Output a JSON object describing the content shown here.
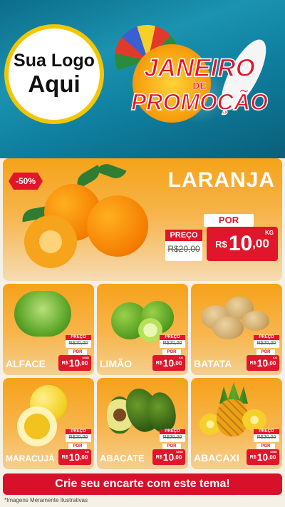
{
  "logo": {
    "line1": "Sua Logo",
    "line2": "Aqui"
  },
  "promo": {
    "line1": "JANEIRO",
    "line2": "DE",
    "line3": "PROMOÇÃO"
  },
  "hero": {
    "name": "LARANJA",
    "discount": "-50%",
    "preco_label": "PREÇO",
    "old_price": "R$20,00",
    "por_label": "POR",
    "currency": "R$",
    "price_int": "10",
    "price_dec": ",00",
    "unit": "KG"
  },
  "products": [
    {
      "name": "ALFACE",
      "preco_label": "PREÇO",
      "old_price": "R$20,00",
      "por_label": "POR",
      "currency": "R$",
      "price_int": "10",
      "price_dec": ",00",
      "unit": "UNID"
    },
    {
      "name": "LIMÃO",
      "preco_label": "PREÇO",
      "old_price": "R$20,00",
      "por_label": "POR",
      "currency": "R$",
      "price_int": "10",
      "price_dec": ",00",
      "unit": "KG"
    },
    {
      "name": "BATATA",
      "preco_label": "PREÇO",
      "old_price": "R$20,00",
      "por_label": "POR",
      "currency": "R$",
      "price_int": "10",
      "price_dec": ",00",
      "unit": "KG"
    },
    {
      "name": "MARACUJÁ",
      "preco_label": "PREÇO",
      "old_price": "R$20,00",
      "por_label": "POR",
      "currency": "R$",
      "price_int": "10",
      "price_dec": ",00",
      "unit": "KG"
    },
    {
      "name": "ABACATE",
      "preco_label": "PREÇO",
      "old_price": "R$20,00",
      "por_label": "POR",
      "currency": "R$",
      "price_int": "10",
      "price_dec": ",00",
      "unit": "UNID"
    },
    {
      "name": "ABACAXI",
      "preco_label": "PREÇO",
      "old_price": "R$20,00",
      "por_label": "POR",
      "currency": "R$",
      "price_int": "10",
      "price_dec": ",00",
      "unit": "UNID"
    }
  ],
  "cta": "Crie seu encarte com este tema!",
  "disclaimer": "*Imagens Meramente Ilustrativas",
  "colors": {
    "accent": "#e0162b",
    "logo_ring": "#f3c600",
    "card_top": "#f6a21a"
  }
}
